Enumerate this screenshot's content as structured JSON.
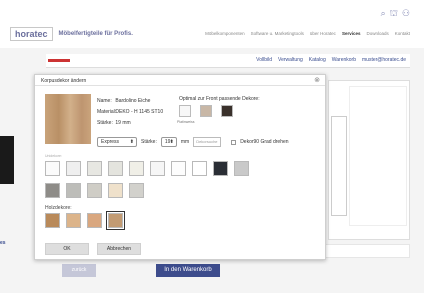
{
  "header": {
    "logo": "horatec",
    "tagline": "Möbelfertigteile für Profis.",
    "icons": [
      "search-icon",
      "cart-icon",
      "user-icon"
    ],
    "nav": [
      "Möbelkomponenten",
      "Software u. Marketingtools",
      "über Horatec",
      "Services",
      "Downloads",
      "Kontakt"
    ],
    "nav_active": "Services"
  },
  "toolbar": {
    "links": [
      "Vollbild",
      "Verwaltung",
      "Katalog",
      "Warenkorb",
      "muster@horatec.de"
    ]
  },
  "dialog": {
    "title": "Korpusdekor ändern",
    "close": "⊗",
    "name_label": "Name:",
    "name_value": "Bardolino Eiche",
    "material_label": "Material:",
    "material_value": "DEKO - H 1145 ST10",
    "strength_label": "Stärke:",
    "strength_value": "19 mm",
    "fit_label": "Optimal zur Front passende Dekore:",
    "fit_caption": "Platinweiss",
    "select_value": "Express",
    "strength_control_label": "Stärke:",
    "strength_control_value": "19",
    "strength_control_unit": "mm",
    "search_placeholder": "Dekorsuche",
    "rotate_label": "Dekor90 Grad drehen",
    "uni_label": "Unidekore:",
    "wood_label": "Holzdekore:",
    "ok": "OK",
    "cancel": "Abbrechen"
  },
  "background": {
    "back_button": "zurück",
    "cart_button": "In den Warenkorb",
    "left_text": "es"
  },
  "colors": {
    "fit": [
      "#f7f7f7",
      "#c8b7a6",
      "#3a312b"
    ],
    "uni_row1": [
      "#fbfbfb",
      "#efefef",
      "#e7e7e2",
      "#e4e4de",
      "#f0efe7",
      "#f6f6f6",
      "#fdfdfd",
      "#ffffff",
      "#2a2e35",
      "#c9c9c9"
    ],
    "uni_row2": [
      "#8e8c88",
      "#bdbdb9",
      "#cfcdc6",
      "#efe1cb",
      "#d2d1cc"
    ],
    "wood": [
      "#b98a5a",
      "#dcb48a",
      "#d9a77f",
      "#c29b73"
    ],
    "accent": "#3d4c8c"
  }
}
